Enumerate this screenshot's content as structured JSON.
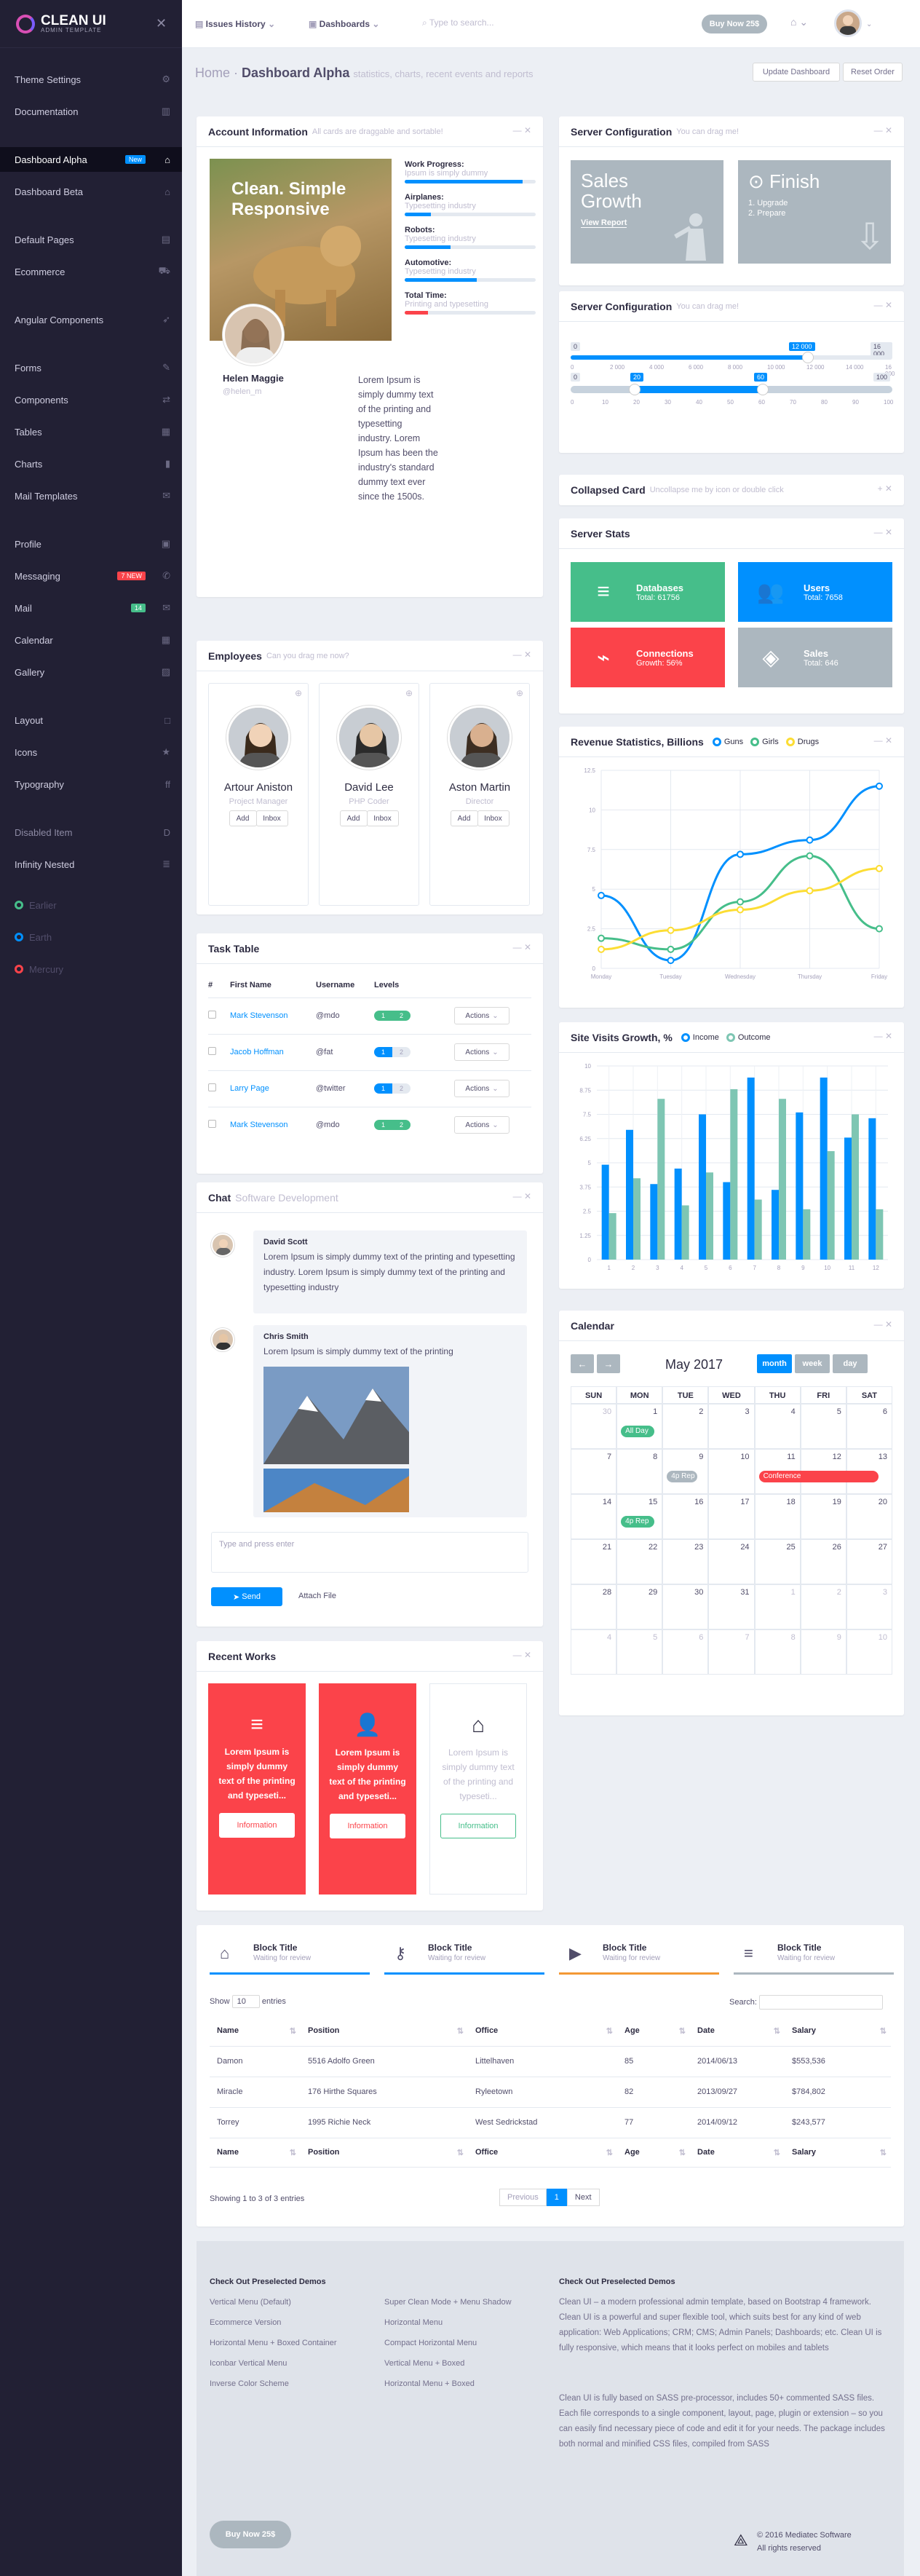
{
  "sidebar": {
    "logo_title": "CLEAN UI",
    "logo_sub": "ADMIN TEMPLATE",
    "items": [
      {
        "label": "Theme Settings",
        "icon": "gear-icon"
      },
      {
        "label": "Documentation",
        "icon": "book-icon"
      },
      {
        "label": "Dashboard Alpha",
        "icon": "home-icon",
        "badge": "New",
        "active": true
      },
      {
        "label": "Dashboard Beta",
        "icon": "home-icon"
      },
      {
        "label": "Default Pages",
        "icon": "file-icon"
      },
      {
        "label": "Ecommerce",
        "icon": "cart-icon"
      },
      {
        "label": "Angular Components",
        "icon": "rocket-icon"
      },
      {
        "label": "Forms",
        "icon": "edit-icon"
      },
      {
        "label": "Components",
        "icon": "transfer-icon"
      },
      {
        "label": "Tables",
        "icon": "table-icon"
      },
      {
        "label": "Charts",
        "icon": "chart-icon"
      },
      {
        "label": "Mail Templates",
        "icon": "mail-icon"
      },
      {
        "label": "Profile",
        "icon": "profile-icon"
      },
      {
        "label": "Messaging",
        "icon": "message-icon",
        "badge": "7 NEW"
      },
      {
        "label": "Mail",
        "icon": "mail-icon",
        "badge": "14"
      },
      {
        "label": "Calendar",
        "icon": "calendar-icon"
      },
      {
        "label": "Gallery",
        "icon": "image-icon"
      },
      {
        "label": "Layout",
        "icon": "layout-icon"
      },
      {
        "label": "Icons",
        "icon": "star-icon"
      },
      {
        "label": "Typography",
        "icon": "type-icon"
      },
      {
        "label": "Disabled Item",
        "icon": "d-icon"
      },
      {
        "label": "Infinity Nested",
        "icon": "nested-icon"
      }
    ],
    "dots": [
      {
        "label": "Earlier",
        "color": "#46be8a"
      },
      {
        "label": "Earth",
        "color": "#0190fe"
      },
      {
        "label": "Mercury",
        "color": "#fb434a"
      }
    ]
  },
  "topbar": {
    "issues": "Issues History",
    "dashboards": "Dashboards",
    "search_placeholder": "Type to search...",
    "buy": "Buy Now 25$"
  },
  "header": {
    "home": "Home",
    "title": "Dashboard Alpha",
    "subtitle": "statistics, charts, recent events and reports",
    "update": "Update Dashboard",
    "reset": "Reset Order"
  },
  "account": {
    "title": "Account Information",
    "hint": "All cards are draggable and sortable!",
    "overlay_title": "Clean. Simple Responsive",
    "name": "Helen Maggie",
    "handle": "@helen_m",
    "bio": "Lorem Ipsum is simply dummy text of the printing and typesetting industry. Lorem Ipsum has been the industry's standard dummy text ever since the 1500s.",
    "progress": [
      {
        "label": "Work Progress:",
        "sub": "Ipsum is simply dummy",
        "value": 0.9,
        "color": "#0190fe"
      },
      {
        "label": "Airplanes:",
        "sub": "Typesetting industry",
        "value": 0.2,
        "color": "#0190fe"
      },
      {
        "label": "Robots:",
        "sub": "Typesetting industry",
        "value": 0.35,
        "color": "#0190fe"
      },
      {
        "label": "Automotive:",
        "sub": "Typesetting industry",
        "value": 0.55,
        "color": "#0190fe"
      },
      {
        "label": "Total Time:",
        "sub": "Printing and typesetting",
        "value": 0.18,
        "color": "#fb434a"
      }
    ]
  },
  "server1": {
    "title": "Server Configuration",
    "hint": "You can drag me!",
    "t1_title": "Sales Growth",
    "t1_link": "View Report",
    "t2_title": "Finish",
    "t2_l1": "1. Upgrade",
    "t2_l2": "2. Prepare"
  },
  "server2": {
    "title": "Server Configuration",
    "hint": "You can drag me!",
    "s1_min": "0",
    "s1_val": "12 000",
    "s1_max": "16 000",
    "s2_min": "0",
    "s2_a": "20",
    "s2_b": "60",
    "s2_max": "100",
    "ticks1": [
      "0",
      "2 000",
      "4 000",
      "6 000",
      "8 000",
      "10 000",
      "12 000",
      "14 000",
      "16 000"
    ],
    "ticks2": [
      "0",
      "10",
      "20",
      "30",
      "40",
      "50",
      "60",
      "70",
      "80",
      "90",
      "100"
    ]
  },
  "collapsed": {
    "title": "Collapsed Card",
    "hint": "Uncollapse me by icon or double click"
  },
  "stats": {
    "title": "Server Stats",
    "items": [
      {
        "title": "Databases",
        "sub": "Total: 61756",
        "color": "#46be8a"
      },
      {
        "title": "Users",
        "sub": "Total: 7658",
        "color": "#0190fe"
      },
      {
        "title": "Connections",
        "sub": "Growth: 56%",
        "color": "#fb434a"
      },
      {
        "title": "Sales",
        "sub": "Total: 646",
        "color": "#acb7bf"
      }
    ]
  },
  "employees": {
    "title": "Employees",
    "hint": "Can you drag me now?",
    "people": [
      {
        "name": "Artour Aniston",
        "role": "Project Manager"
      },
      {
        "name": "David Lee",
        "role": "PHP Coder"
      },
      {
        "name": "Aston Martin",
        "role": "Director"
      }
    ],
    "add": "Add",
    "inbox": "Inbox"
  },
  "tasks": {
    "title": "Task Table",
    "headers": [
      "#",
      "First Name",
      "Username",
      "Levels",
      ""
    ],
    "rows": [
      {
        "name": "Mark Stevenson",
        "user": "@mdo",
        "l1": "1",
        "l2": "2",
        "g": true
      },
      {
        "name": "Jacob Hoffman",
        "user": "@fat",
        "l1": "1",
        "l2": "2",
        "g": false
      },
      {
        "name": "Larry Page",
        "user": "@twitter",
        "l1": "1",
        "l2": "2",
        "g": false
      },
      {
        "name": "Mark Stevenson",
        "user": "@mdo",
        "l1": "1",
        "l2": "2",
        "g": true
      }
    ],
    "actions": "Actions"
  },
  "chat": {
    "title": "Chat",
    "hint": "Software Development",
    "m1_name": "David Scott",
    "m1_text": "Lorem Ipsum is simply dummy text of the printing and typesetting industry. Lorem Ipsum is simply dummy text of the printing and typesetting industry",
    "m2_name": "Chris Smith",
    "m2_text": "Lorem Ipsum is simply dummy text of the printing",
    "placeholder": "Type and press enter",
    "send": "Send",
    "attach": "Attach File"
  },
  "works": {
    "title": "Recent Works",
    "text": "Lorem Ipsum is simply dummy text of the printing and typeseti...",
    "btn": "Information"
  },
  "revenue": {
    "title": "Revenue Statistics, Billions",
    "legend": [
      "Guns",
      "Girls",
      "Drugs"
    ]
  },
  "visits": {
    "title": "Site Visits Growth, %",
    "legend": [
      "Income",
      "Outcome"
    ]
  },
  "calendar": {
    "title": "Calendar",
    "month": "May 2017",
    "views": [
      "month",
      "week",
      "day"
    ],
    "days": [
      "SUN",
      "MON",
      "TUE",
      "WED",
      "THU",
      "FRI",
      "SAT"
    ],
    "weeks": [
      [
        "30",
        "1",
        "2",
        "3",
        "4",
        "5",
        "6"
      ],
      [
        "7",
        "8",
        "9",
        "10",
        "11",
        "12",
        "13"
      ],
      [
        "14",
        "15",
        "16",
        "17",
        "18",
        "19",
        "20"
      ],
      [
        "21",
        "22",
        "23",
        "24",
        "25",
        "26",
        "27"
      ],
      [
        "28",
        "29",
        "30",
        "31",
        "1",
        "2",
        "3"
      ],
      [
        "4",
        "5",
        "6",
        "7",
        "8",
        "9",
        "10"
      ]
    ],
    "events": [
      {
        "label": "All Day",
        "color": "#46be8a"
      },
      {
        "label": "4p Rep",
        "color": "#acb7bf"
      },
      {
        "label": "Conference",
        "color": "#fb434a"
      },
      {
        "label": "4p Rep",
        "color": "#46be8a"
      }
    ]
  },
  "blocks": [
    {
      "title": "Block Title",
      "sub": "Waiting for review",
      "color": "#0190fe",
      "icon": "home-icon"
    },
    {
      "title": "Block Title",
      "sub": "Waiting for review",
      "color": "#0190fe",
      "icon": "key-icon"
    },
    {
      "title": "Block Title",
      "sub": "Waiting for review",
      "color": "#f39834",
      "icon": "play-icon"
    },
    {
      "title": "Block Title",
      "sub": "Waiting for review",
      "color": "#acb7bf",
      "icon": "database-icon"
    }
  ],
  "datatable": {
    "show": "Show",
    "entries_count": "10",
    "entries": "entries",
    "search": "Search:",
    "headers": [
      "Name",
      "Position",
      "Office",
      "Age",
      "Date",
      "Salary"
    ],
    "rows": [
      [
        "Damon",
        "5516 Adolfo Green",
        "Littelhaven",
        "85",
        "2014/06/13",
        "$553,536"
      ],
      [
        "Miracle",
        "176 Hirthe Squares",
        "Ryleetown",
        "82",
        "2013/09/27",
        "$784,802"
      ],
      [
        "Torrey",
        "1995 Richie Neck",
        "West Sedrickstad",
        "77",
        "2014/09/12",
        "$243,577"
      ]
    ],
    "info": "Showing 1 to 3 of 3 entries",
    "prev": "Previous",
    "page": "1",
    "next": "Next"
  },
  "footer": {
    "h1": "Check Out Preselected Demos",
    "col1": [
      "Vertical Menu (Default)",
      "Ecommerce Version",
      "Horizontal Menu + Boxed Container",
      "Iconbar Vertical Menu",
      "Inverse Color Scheme"
    ],
    "col2": [
      "Super Clean Mode + Menu Shadow",
      "Horizontal Menu",
      "Compact Horizontal Menu",
      "Vertical Menu + Boxed",
      "Horizontal Menu + Boxed"
    ],
    "h2": "Check Out Preselected Demos",
    "p1": "Clean UI – a modern professional admin template, based on Bootstrap 4 framework. Clean UI is a powerful and super flexible tool, which suits best for any kind of web application: Web Applications; CRM; CMS; Admin Panels; Dashboards; etc. Clean UI is fully responsive, which means that it looks perfect on mobiles and tablets",
    "p2": "Clean UI is fully based on SASS pre-processor, includes 50+ commented SASS files. Each file corresponds to a single component, layout, page, plugin or extension – so you can easily find necessary piece of code and edit it for your needs. The package includes both normal and minified CSS files, compiled from SASS",
    "buy": "Buy Now 25$",
    "copy1": "© 2016 Mediatec Software",
    "copy2": "All rights reserved"
  },
  "chart_data": [
    {
      "type": "line",
      "title": "Revenue Statistics, Billions",
      "categories": [
        "Monday",
        "Tuesday",
        "Wednesday",
        "Thursday",
        "Friday"
      ],
      "ylim": [
        0,
        12.5
      ],
      "yticks": [
        "0",
        "2.5",
        "5",
        "7.5",
        "10",
        "12.5"
      ],
      "series": [
        {
          "name": "Guns",
          "color": "#0190fe",
          "values": [
            4.6,
            0.5,
            7.2,
            8.1,
            11.5
          ]
        },
        {
          "name": "Girls",
          "color": "#46be8a",
          "values": [
            1.9,
            1.2,
            4.2,
            7.1,
            2.5
          ]
        },
        {
          "name": "Drugs",
          "color": "#fcdd34",
          "values": [
            1.2,
            2.4,
            3.7,
            4.9,
            6.3
          ]
        }
      ]
    },
    {
      "type": "bar",
      "title": "Site Visits Growth, %",
      "categories": [
        "1",
        "2",
        "3",
        "4",
        "5",
        "6",
        "7",
        "8",
        "9",
        "10",
        "11",
        "12"
      ],
      "ylim": [
        0,
        10
      ],
      "yticks": [
        "0",
        "1.25",
        "2.5",
        "3.75",
        "5",
        "6.25",
        "7.5",
        "8.75",
        "10"
      ],
      "series": [
        {
          "name": "Income",
          "color": "#0190fe",
          "values": [
            4.9,
            6.7,
            3.9,
            4.7,
            7.5,
            4.0,
            9.4,
            3.6,
            7.6,
            9.4,
            6.3,
            7.3
          ]
        },
        {
          "name": "Outcome",
          "color": "#7ec6b3",
          "values": [
            2.4,
            4.2,
            8.3,
            2.8,
            4.5,
            8.8,
            3.1,
            8.3,
            2.6,
            5.6,
            7.5,
            2.6
          ]
        }
      ]
    }
  ]
}
